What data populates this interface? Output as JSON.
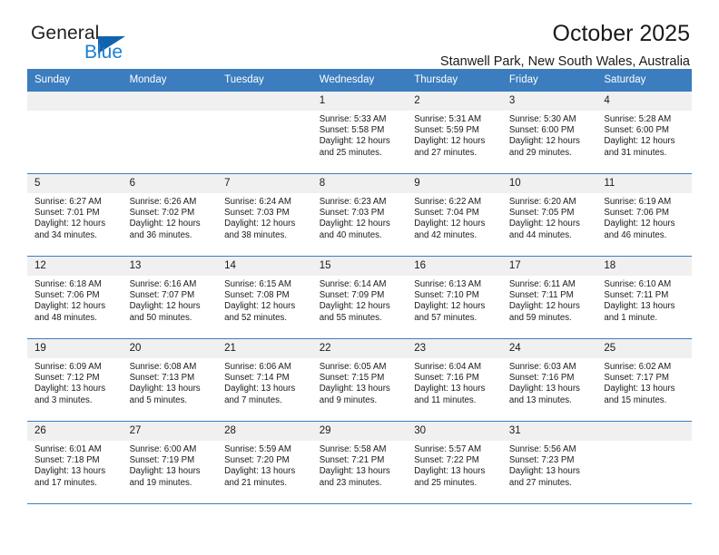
{
  "brand": {
    "name_primary": "General",
    "name_secondary": "Blue",
    "triangle_color": "#1263ad",
    "blue_color": "#1b7fd4"
  },
  "header": {
    "title": "October 2025",
    "subtitle": "Stanwell Park, New South Wales, Australia",
    "accent_color": "#3b7dbe",
    "daynum_bg": "#f0f0f0"
  },
  "weekdays": [
    "Sunday",
    "Monday",
    "Tuesday",
    "Wednesday",
    "Thursday",
    "Friday",
    "Saturday"
  ],
  "labels": {
    "sunrise": "Sunrise:",
    "sunset": "Sunset:",
    "daylight": "Daylight:"
  },
  "weeks": [
    [
      {
        "day": "",
        "empty": true
      },
      {
        "day": "",
        "empty": true
      },
      {
        "day": "",
        "empty": true
      },
      {
        "day": "1",
        "sunrise": "Sunrise: 5:33 AM",
        "sunset": "Sunset: 5:58 PM",
        "daylight_1": "Daylight: 12 hours",
        "daylight_2": "and 25 minutes."
      },
      {
        "day": "2",
        "sunrise": "Sunrise: 5:31 AM",
        "sunset": "Sunset: 5:59 PM",
        "daylight_1": "Daylight: 12 hours",
        "daylight_2": "and 27 minutes."
      },
      {
        "day": "3",
        "sunrise": "Sunrise: 5:30 AM",
        "sunset": "Sunset: 6:00 PM",
        "daylight_1": "Daylight: 12 hours",
        "daylight_2": "and 29 minutes."
      },
      {
        "day": "4",
        "sunrise": "Sunrise: 5:28 AM",
        "sunset": "Sunset: 6:00 PM",
        "daylight_1": "Daylight: 12 hours",
        "daylight_2": "and 31 minutes."
      }
    ],
    [
      {
        "day": "5",
        "sunrise": "Sunrise: 6:27 AM",
        "sunset": "Sunset: 7:01 PM",
        "daylight_1": "Daylight: 12 hours",
        "daylight_2": "and 34 minutes."
      },
      {
        "day": "6",
        "sunrise": "Sunrise: 6:26 AM",
        "sunset": "Sunset: 7:02 PM",
        "daylight_1": "Daylight: 12 hours",
        "daylight_2": "and 36 minutes."
      },
      {
        "day": "7",
        "sunrise": "Sunrise: 6:24 AM",
        "sunset": "Sunset: 7:03 PM",
        "daylight_1": "Daylight: 12 hours",
        "daylight_2": "and 38 minutes."
      },
      {
        "day": "8",
        "sunrise": "Sunrise: 6:23 AM",
        "sunset": "Sunset: 7:03 PM",
        "daylight_1": "Daylight: 12 hours",
        "daylight_2": "and 40 minutes."
      },
      {
        "day": "9",
        "sunrise": "Sunrise: 6:22 AM",
        "sunset": "Sunset: 7:04 PM",
        "daylight_1": "Daylight: 12 hours",
        "daylight_2": "and 42 minutes."
      },
      {
        "day": "10",
        "sunrise": "Sunrise: 6:20 AM",
        "sunset": "Sunset: 7:05 PM",
        "daylight_1": "Daylight: 12 hours",
        "daylight_2": "and 44 minutes."
      },
      {
        "day": "11",
        "sunrise": "Sunrise: 6:19 AM",
        "sunset": "Sunset: 7:06 PM",
        "daylight_1": "Daylight: 12 hours",
        "daylight_2": "and 46 minutes."
      }
    ],
    [
      {
        "day": "12",
        "sunrise": "Sunrise: 6:18 AM",
        "sunset": "Sunset: 7:06 PM",
        "daylight_1": "Daylight: 12 hours",
        "daylight_2": "and 48 minutes."
      },
      {
        "day": "13",
        "sunrise": "Sunrise: 6:16 AM",
        "sunset": "Sunset: 7:07 PM",
        "daylight_1": "Daylight: 12 hours",
        "daylight_2": "and 50 minutes."
      },
      {
        "day": "14",
        "sunrise": "Sunrise: 6:15 AM",
        "sunset": "Sunset: 7:08 PM",
        "daylight_1": "Daylight: 12 hours",
        "daylight_2": "and 52 minutes."
      },
      {
        "day": "15",
        "sunrise": "Sunrise: 6:14 AM",
        "sunset": "Sunset: 7:09 PM",
        "daylight_1": "Daylight: 12 hours",
        "daylight_2": "and 55 minutes."
      },
      {
        "day": "16",
        "sunrise": "Sunrise: 6:13 AM",
        "sunset": "Sunset: 7:10 PM",
        "daylight_1": "Daylight: 12 hours",
        "daylight_2": "and 57 minutes."
      },
      {
        "day": "17",
        "sunrise": "Sunrise: 6:11 AM",
        "sunset": "Sunset: 7:11 PM",
        "daylight_1": "Daylight: 12 hours",
        "daylight_2": "and 59 minutes."
      },
      {
        "day": "18",
        "sunrise": "Sunrise: 6:10 AM",
        "sunset": "Sunset: 7:11 PM",
        "daylight_1": "Daylight: 13 hours",
        "daylight_2": "and 1 minute."
      }
    ],
    [
      {
        "day": "19",
        "sunrise": "Sunrise: 6:09 AM",
        "sunset": "Sunset: 7:12 PM",
        "daylight_1": "Daylight: 13 hours",
        "daylight_2": "and 3 minutes."
      },
      {
        "day": "20",
        "sunrise": "Sunrise: 6:08 AM",
        "sunset": "Sunset: 7:13 PM",
        "daylight_1": "Daylight: 13 hours",
        "daylight_2": "and 5 minutes."
      },
      {
        "day": "21",
        "sunrise": "Sunrise: 6:06 AM",
        "sunset": "Sunset: 7:14 PM",
        "daylight_1": "Daylight: 13 hours",
        "daylight_2": "and 7 minutes."
      },
      {
        "day": "22",
        "sunrise": "Sunrise: 6:05 AM",
        "sunset": "Sunset: 7:15 PM",
        "daylight_1": "Daylight: 13 hours",
        "daylight_2": "and 9 minutes."
      },
      {
        "day": "23",
        "sunrise": "Sunrise: 6:04 AM",
        "sunset": "Sunset: 7:16 PM",
        "daylight_1": "Daylight: 13 hours",
        "daylight_2": "and 11 minutes."
      },
      {
        "day": "24",
        "sunrise": "Sunrise: 6:03 AM",
        "sunset": "Sunset: 7:16 PM",
        "daylight_1": "Daylight: 13 hours",
        "daylight_2": "and 13 minutes."
      },
      {
        "day": "25",
        "sunrise": "Sunrise: 6:02 AM",
        "sunset": "Sunset: 7:17 PM",
        "daylight_1": "Daylight: 13 hours",
        "daylight_2": "and 15 minutes."
      }
    ],
    [
      {
        "day": "26",
        "sunrise": "Sunrise: 6:01 AM",
        "sunset": "Sunset: 7:18 PM",
        "daylight_1": "Daylight: 13 hours",
        "daylight_2": "and 17 minutes."
      },
      {
        "day": "27",
        "sunrise": "Sunrise: 6:00 AM",
        "sunset": "Sunset: 7:19 PM",
        "daylight_1": "Daylight: 13 hours",
        "daylight_2": "and 19 minutes."
      },
      {
        "day": "28",
        "sunrise": "Sunrise: 5:59 AM",
        "sunset": "Sunset: 7:20 PM",
        "daylight_1": "Daylight: 13 hours",
        "daylight_2": "and 21 minutes."
      },
      {
        "day": "29",
        "sunrise": "Sunrise: 5:58 AM",
        "sunset": "Sunset: 7:21 PM",
        "daylight_1": "Daylight: 13 hours",
        "daylight_2": "and 23 minutes."
      },
      {
        "day": "30",
        "sunrise": "Sunrise: 5:57 AM",
        "sunset": "Sunset: 7:22 PM",
        "daylight_1": "Daylight: 13 hours",
        "daylight_2": "and 25 minutes."
      },
      {
        "day": "31",
        "sunrise": "Sunrise: 5:56 AM",
        "sunset": "Sunset: 7:23 PM",
        "daylight_1": "Daylight: 13 hours",
        "daylight_2": "and 27 minutes."
      },
      {
        "day": "",
        "empty": true
      }
    ]
  ]
}
